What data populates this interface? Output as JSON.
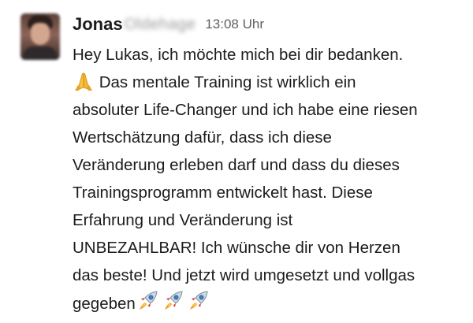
{
  "message": {
    "sender_first_name": "Jonas",
    "sender_surname_redacted": "Oldehage",
    "timestamp": "13:08 Uhr",
    "lines": [
      "Hey Lukas, ich möchte mich bei dir bedanken.",
      "Das mentale Training ist wirklich ein",
      "absoluter Life-Changer und ich habe eine riesen",
      "Wertschätzung dafür, dass ich diese",
      "Veränderung erleben darf und dass du dieses",
      "Trainingsprogramm entwickelt hast. Diese",
      "Erfahrung und Veränderung ist",
      "UNBEZAHLBAR! Ich wünsche dir von Herzen",
      "das beste! Und jetzt wird umgesetzt und vollgas",
      "gegeben"
    ],
    "emojis": {
      "pray": "folded-hands-icon",
      "rocket": "rocket-icon",
      "rocket_count": 3
    }
  },
  "colors": {
    "text": "#1d1c1d",
    "timestamp": "#616061",
    "background": "#ffffff"
  }
}
